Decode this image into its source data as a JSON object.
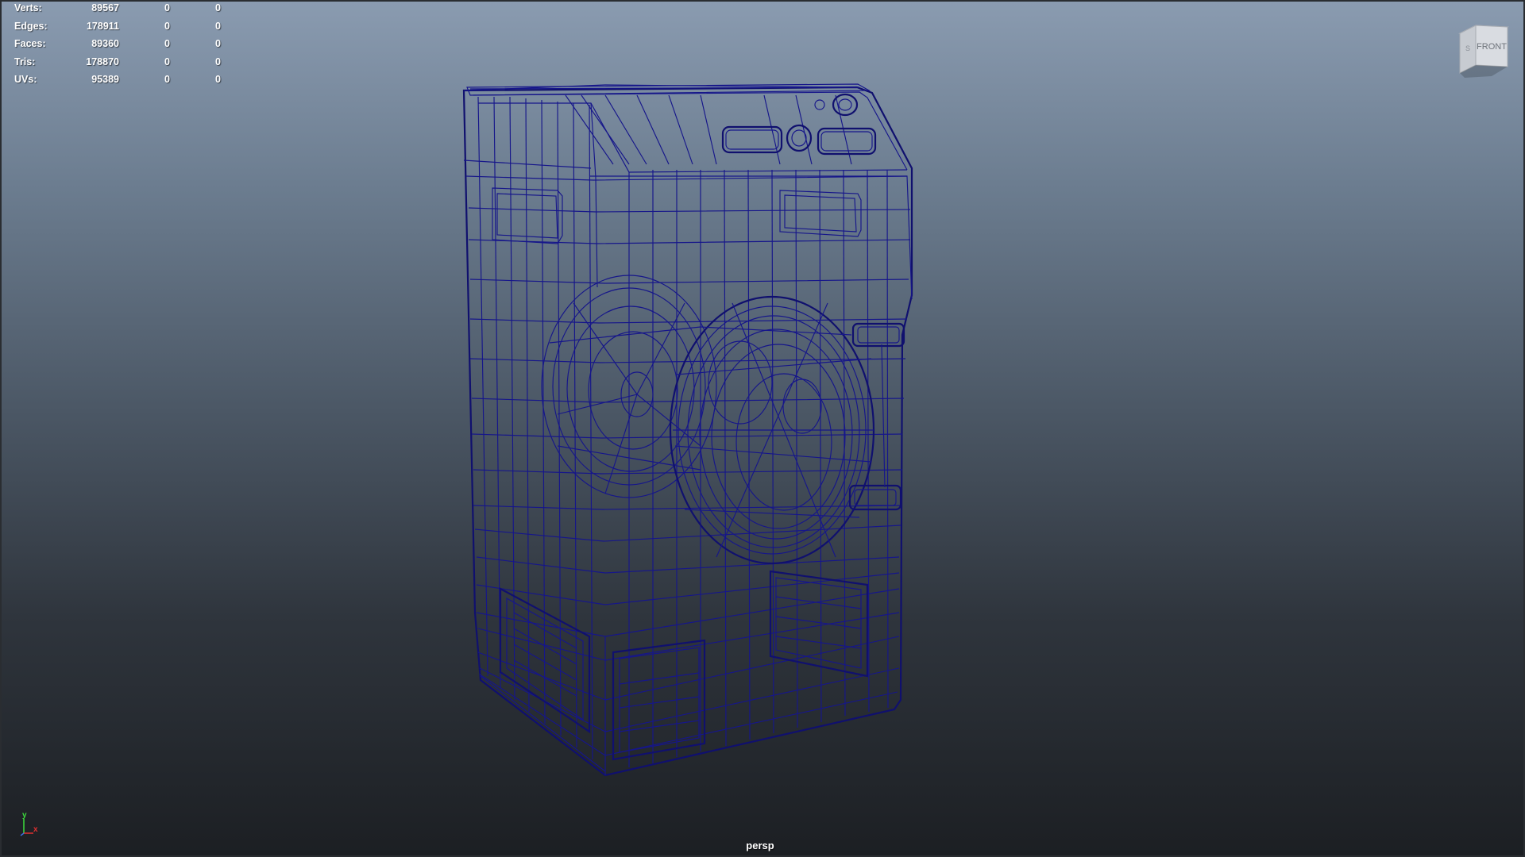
{
  "heads_up_display": {
    "rows": [
      {
        "label": "Verts:",
        "values": [
          "89567",
          "0",
          "0"
        ]
      },
      {
        "label": "Edges:",
        "values": [
          "178911",
          "0",
          "0"
        ]
      },
      {
        "label": "Faces:",
        "values": [
          "89360",
          "0",
          "0"
        ]
      },
      {
        "label": "Tris:",
        "values": [
          "178870",
          "0",
          "0"
        ]
      },
      {
        "label": "UVs:",
        "values": [
          "95389",
          "0",
          "0"
        ]
      }
    ]
  },
  "viewcube": {
    "front_label": "FRONT",
    "side_label": "S",
    "icon": "viewcube-icon"
  },
  "axis_gizmo": {
    "y_label": "y",
    "x_label": "x",
    "y_color": "#3ddc3d",
    "x_color": "#e03030",
    "icon": "axis-gizmo-icon"
  },
  "viewport": {
    "camera_name": "persp",
    "background_top": "#8a9bb0",
    "background_bottom": "#1c1f23",
    "wireframe_color": "#16168a",
    "model_icon": "wireframe-dryer-model"
  }
}
